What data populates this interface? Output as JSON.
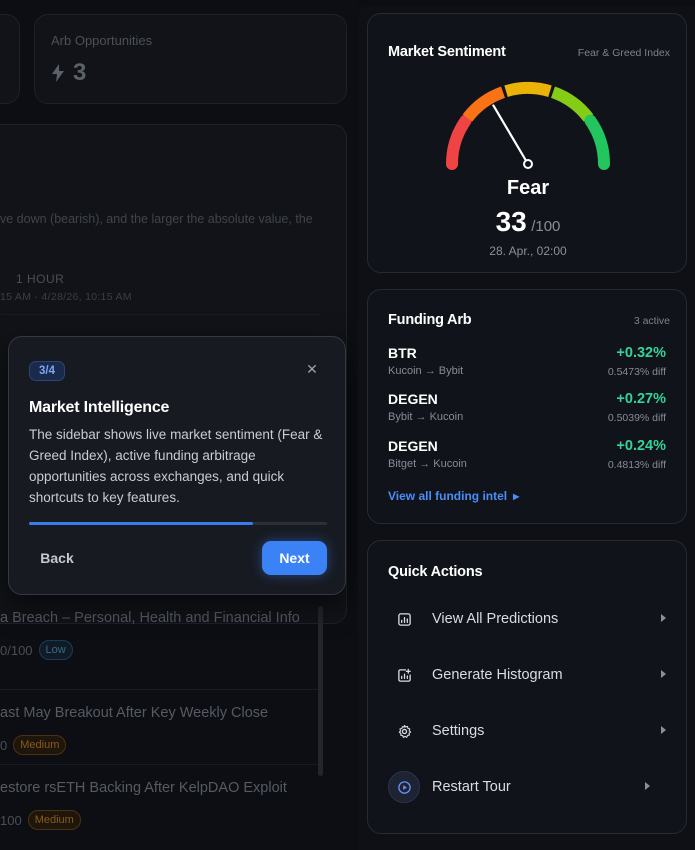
{
  "background": {
    "stat_card": {
      "label": "Arb Opportunities",
      "value": "3",
      "icon": "bolt-icon"
    },
    "info_text": "ve down (bearish), and the larger the absolute value, the",
    "timeframe_label": "1 HOUR",
    "timeframe_range": "15 AM - 4/28/26, 10:15 AM",
    "news": [
      {
        "title": "a Breach – Personal, Health and Financial Info",
        "score": "0/100",
        "risk": "Low"
      },
      {
        "title": "ast May Breakout After Key Weekly Close",
        "score": "0",
        "risk": "Medium"
      },
      {
        "title": "estore rsETH Backing After KelpDAO Exploit",
        "score": "100",
        "risk": "Medium"
      }
    ]
  },
  "tour": {
    "step": "3/4",
    "close_icon": "close-icon",
    "title": "Market Intelligence",
    "body": "The sidebar shows live market sentiment (Fear & Greed Index), active funding arbitrage opportunities across exchanges, and quick shortcuts to key features.",
    "progress_fraction": 0.75,
    "back_label": "Back",
    "next_label": "Next"
  },
  "sentiment": {
    "title": "Market Sentiment",
    "subtitle": "Fear & Greed Index",
    "label": "Fear",
    "value": "33",
    "max": "/100",
    "value_number": 33,
    "timestamp": "28. Apr., 02:00",
    "gauge_colors": [
      "#ef4444",
      "#f97316",
      "#eab308",
      "#84cc16",
      "#22c55e"
    ]
  },
  "funding": {
    "title": "Funding Arb",
    "count": "3 active",
    "rows": [
      {
        "coin": "BTR",
        "route": "Kucoin → Bybit",
        "rate": "+0.32%",
        "diff": "0.5473% diff"
      },
      {
        "coin": "DEGEN",
        "route": "Bybit → Kucoin",
        "rate": "+0.27%",
        "diff": "0.5039% diff"
      },
      {
        "coin": "DEGEN",
        "route": "Bitget → Kucoin",
        "rate": "+0.24%",
        "diff": "0.4813% diff"
      }
    ],
    "view_all": "View all funding intel",
    "accent_color": "#34d399"
  },
  "quick_actions": {
    "title": "Quick Actions",
    "items": [
      {
        "label": "View All Predictions",
        "icon": "chart-icon"
      },
      {
        "label": "Generate Histogram",
        "icon": "histogram-icon"
      },
      {
        "label": "Settings",
        "icon": "gear-icon"
      },
      {
        "label": "Restart Tour",
        "icon": "play-circle-icon"
      }
    ]
  }
}
